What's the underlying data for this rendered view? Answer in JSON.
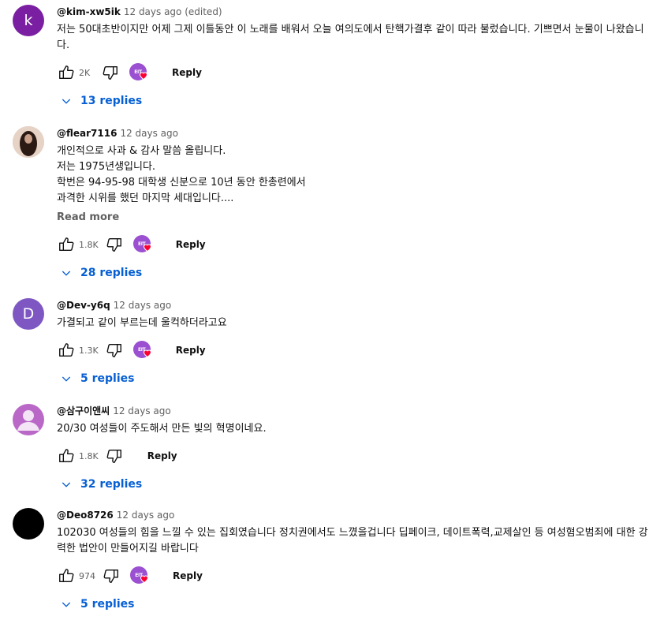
{
  "comments": [
    {
      "author": "@kim-xw5ik",
      "time": "12 days ago (edited)",
      "avatar": {
        "letter": "k",
        "color": "#7b1fa2",
        "kind": "letter"
      },
      "text": "저는 50대초반이지만 어제 그제 이틀동안 이 노래를 배워서 오늘 여의도에서 탄핵가결후 같이 따라 불렀습니다. 기쁘면서 눈물이 나왔습니다.",
      "likes": "2K",
      "hearted": true,
      "reply_label": "Reply",
      "replies_label": "13 replies"
    },
    {
      "author": "@flear7116",
      "time": "12 days ago",
      "avatar": {
        "letter": "",
        "color": "#c9a68f",
        "kind": "photo"
      },
      "text": "개인적으로 사과 & 감사 말씀 올립니다.\n저는 1975년생입니다.\n학번은 94-95-98 대학생 신분으로 10년 동안 한총련에서\n과격한 시위를 했던 마지막 세대입니다....",
      "read_more": "Read more",
      "likes": "1.8K",
      "hearted": true,
      "reply_label": "Reply",
      "replies_label": "28 replies"
    },
    {
      "author": "@Dev-y6q",
      "time": "12 days ago",
      "avatar": {
        "letter": "D",
        "color": "#7e57c2",
        "kind": "letter"
      },
      "text": "가결되고 같이 부르는데 울컥하더라고요",
      "likes": "1.3K",
      "hearted": true,
      "reply_label": "Reply",
      "replies_label": "5 replies"
    },
    {
      "author": "@삼구이앤씨",
      "time": "12 days ago",
      "avatar": {
        "letter": "",
        "color": "#ba68c8",
        "kind": "person"
      },
      "text": "20/30 여성들이 주도해서 만든 빛의 혁명이네요.",
      "likes": "1.8K",
      "hearted": false,
      "reply_label": "Reply",
      "replies_label": "32 replies"
    },
    {
      "author": "@Deo8726",
      "time": "12 days ago",
      "avatar": {
        "letter": "",
        "color": "#000000",
        "kind": "solid"
      },
      "text": "102030 여성들의 힘을 느낄 수 있는 집회였습니다 정치권에서도 느꼈을겁니다 딥페이크, 데이트폭력,교제살인 등 여성혐오범죄에 대한 강력한 법안이 만들어지길 바랍니다",
      "likes": "974",
      "hearted": true,
      "reply_label": "Reply",
      "replies_label": "5 replies"
    }
  ],
  "hearted_badge_text": "EIT",
  "colors": {
    "link": "#065fd4",
    "muted": "#606060",
    "heart": "#ff0033"
  }
}
